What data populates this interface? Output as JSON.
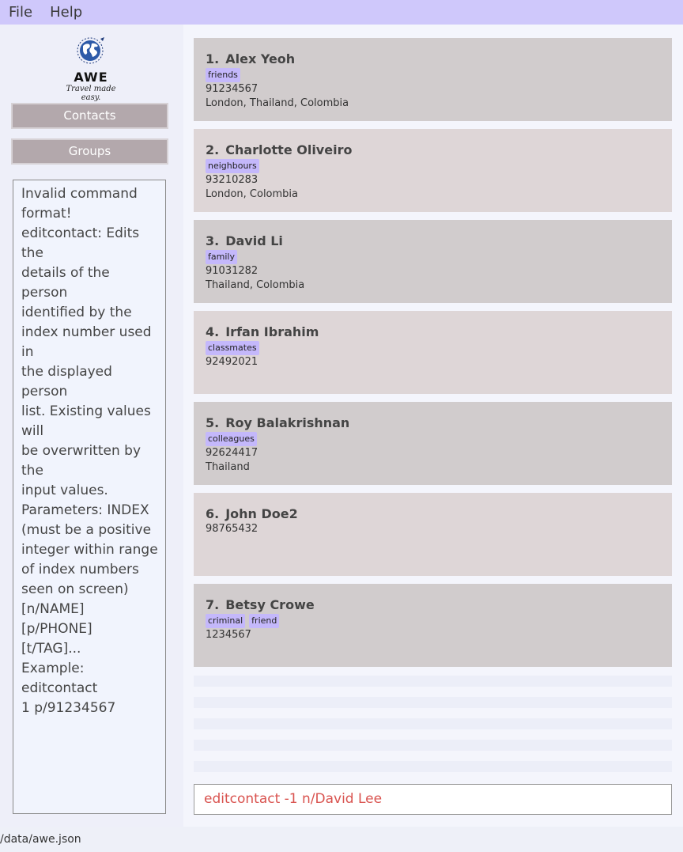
{
  "menu": {
    "file": "File",
    "help": "Help"
  },
  "logo": {
    "title": "AWE",
    "tagline": "Travel made easy."
  },
  "nav": {
    "contacts": "Contacts",
    "groups": "Groups"
  },
  "result": {
    "lines": [
      "Invalid command",
      "format!",
      "editcontact: Edits the",
      "details of the person",
      "identified by the",
      "index number used in",
      "the displayed person",
      "list. Existing values will",
      "be overwritten by the",
      "input values.",
      "Parameters: INDEX",
      "(must be a positive",
      "integer within range",
      "of index numbers",
      "seen on screen)",
      "[n/NAME] [p/PHONE]",
      "[t/TAG]...",
      "Example: editcontact",
      "1 p/91234567"
    ]
  },
  "persons": [
    {
      "index": "1.",
      "name": "Alex Yeoh",
      "tags": [
        "friends"
      ],
      "phone": "91234567",
      "places": "London, Thailand, Colombia"
    },
    {
      "index": "2.",
      "name": "Charlotte Oliveiro",
      "tags": [
        "neighbours"
      ],
      "phone": "93210283",
      "places": "London, Colombia"
    },
    {
      "index": "3.",
      "name": "David Li",
      "tags": [
        "family"
      ],
      "phone": "91031282",
      "places": "Thailand, Colombia"
    },
    {
      "index": "4.",
      "name": "Irfan Ibrahim",
      "tags": [
        "classmates"
      ],
      "phone": "92492021",
      "places": ""
    },
    {
      "index": "5.",
      "name": "Roy Balakrishnan",
      "tags": [
        "colleagues"
      ],
      "phone": "92624417",
      "places": "Thailand"
    },
    {
      "index": "6.",
      "name": "John Doe2",
      "tags": [],
      "phone": "98765432",
      "places": ""
    },
    {
      "index": "7.",
      "name": "Betsy Crowe",
      "tags": [
        "criminal",
        "friend"
      ],
      "phone": "1234567",
      "places": ""
    }
  ],
  "command": {
    "value": "editcontact -1 n/David Lee"
  },
  "status": {
    "path": "/data/awe.json"
  }
}
